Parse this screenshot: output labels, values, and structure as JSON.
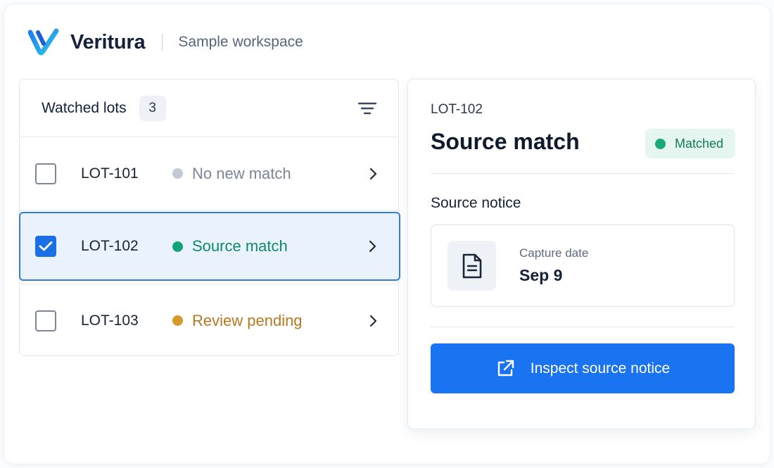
{
  "header": {
    "brand": "Veritura",
    "workspace": "Sample workspace"
  },
  "list": {
    "title": "Watched lots",
    "count": "3",
    "filter_icon": "filter-icon",
    "rows": [
      {
        "lot": "LOT-101",
        "status": "No new match",
        "status_color": "#7a8596",
        "dot_color": "#c4cad3",
        "checked": false
      },
      {
        "lot": "LOT-102",
        "status": "Source match",
        "status_color": "#0f8a66",
        "dot_color": "#11a37a",
        "checked": true
      },
      {
        "lot": "LOT-103",
        "status": "Review pending",
        "status_color": "#b7791f",
        "dot_color": "#d69a2a",
        "checked": false
      }
    ]
  },
  "detail": {
    "lot_id": "LOT-102",
    "title": "Source match",
    "badge": "Matched",
    "section_label": "Source notice",
    "capture_label": "Capture date",
    "capture_value": "Sep 9",
    "action_label": "Inspect source notice"
  },
  "colors": {
    "accent": "#1a73f0",
    "selected_row_bg": "#eaf3fd",
    "matched_bg": "#e4f6ef"
  }
}
